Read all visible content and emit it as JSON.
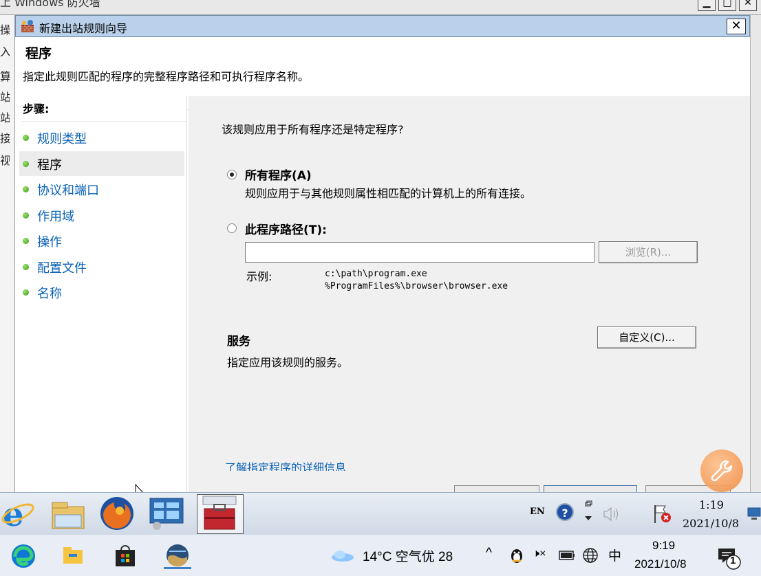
{
  "background_window": {
    "title_fragment": "上 Windows 防火墙",
    "minimize": "▁",
    "maximize": "□",
    "close": "✕",
    "left_chars": [
      "操",
      "入",
      "算",
      "站",
      "站",
      "接",
      "视"
    ]
  },
  "dialog": {
    "title": "新建出站规则向导",
    "close_label": "✕",
    "page_title": "程序",
    "page_subtitle": "指定此规则匹配的程序的完整程序路径和可执行程序名称。",
    "steps_label": "步骤:",
    "steps": [
      {
        "label": "规则类型",
        "current": false
      },
      {
        "label": "程序",
        "current": true
      },
      {
        "label": "协议和端口",
        "current": false
      },
      {
        "label": "作用域",
        "current": false
      },
      {
        "label": "操作",
        "current": false
      },
      {
        "label": "配置文件",
        "current": false
      },
      {
        "label": "名称",
        "current": false
      }
    ],
    "question": "该规则应用于所有程序还是特定程序?",
    "option_all": {
      "label": "所有程序(A)",
      "description": "规则应用于与其他规则属性相匹配的计算机上的所有连接。",
      "checked": true
    },
    "option_path": {
      "label": "此程序路径(T):",
      "checked": false,
      "value": "",
      "browse_label": "浏览(R)..."
    },
    "example_label": "示例:",
    "example_lines": [
      "c:\\path\\program.exe",
      "%ProgramFiles%\\browser\\browser.exe"
    ],
    "services_title": "服务",
    "services_desc": "指定应用该规则的服务。",
    "customize_label": "自定义(C)...",
    "learn_more": "了解指定程序的详细信息"
  },
  "inner_taskbar": {
    "apps": [
      "ie-icon",
      "explorer-icon",
      "firefox-icon",
      "control-panel-icon",
      "toolbox-icon"
    ],
    "ime": "EN",
    "help": "?",
    "time": "1:19",
    "date": "2021/10/8"
  },
  "outer_taskbar": {
    "apps": [
      "edge-icon",
      "file-explorer-icon",
      "store-icon",
      "remote-desktop-icon"
    ],
    "weather": "14°C 空气优 28",
    "tray": {
      "chevron": "^",
      "volume": "🕨×",
      "ime": "中"
    },
    "time": "9:19",
    "date": "2021/10/8",
    "notification_count": "1"
  }
}
